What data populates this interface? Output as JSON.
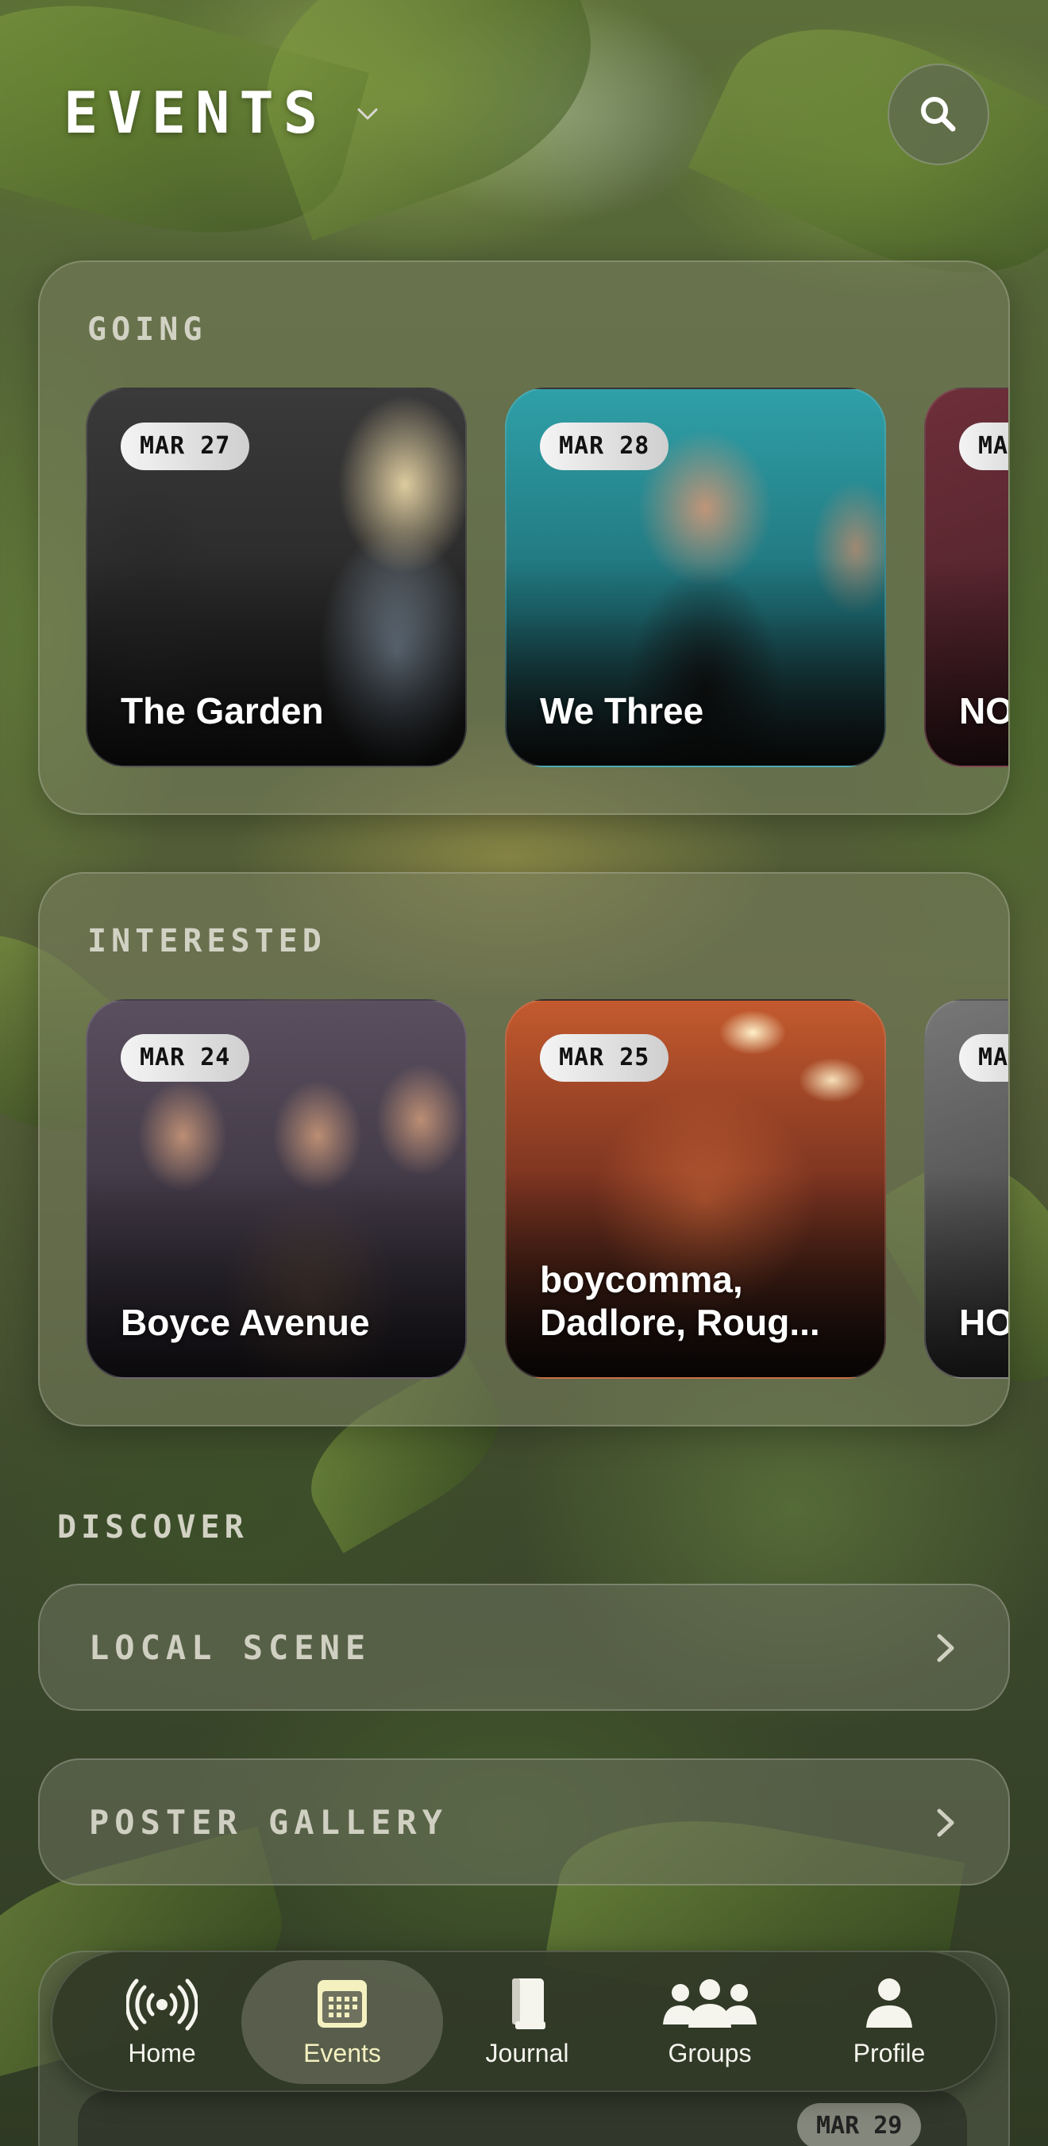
{
  "header": {
    "title": "EVENTS"
  },
  "sections": {
    "going": {
      "label": "GOING",
      "cards": [
        {
          "date": "MAR 27",
          "title": "The Garden"
        },
        {
          "date": "MAR 28",
          "title": "We Three"
        },
        {
          "date": "MAR",
          "title": "NO"
        }
      ]
    },
    "interested": {
      "label": "INTERESTED",
      "cards": [
        {
          "date": "MAR 24",
          "title": "Boyce Avenue"
        },
        {
          "date": "MAR 25",
          "title": "boycomma, Dadlore, Roug..."
        },
        {
          "date": "MAR",
          "title": "HO"
        }
      ]
    },
    "discover": {
      "label": "DISCOVER",
      "rows": [
        {
          "label": "LOCAL SCENE"
        },
        {
          "label": "POSTER GALLERY"
        }
      ]
    },
    "peek": {
      "date": "MAR 29"
    }
  },
  "nav": {
    "active": "Events",
    "tabs": [
      {
        "label": "Home",
        "icon": "broadcast-icon"
      },
      {
        "label": "Events",
        "icon": "calendar-icon"
      },
      {
        "label": "Journal",
        "icon": "book-icon"
      },
      {
        "label": "Groups",
        "icon": "people-icon"
      },
      {
        "label": "Profile",
        "icon": "person-icon"
      }
    ]
  },
  "colors": {
    "active_tab": "#f4f0c0",
    "date_pill": "#e6e6e6"
  }
}
